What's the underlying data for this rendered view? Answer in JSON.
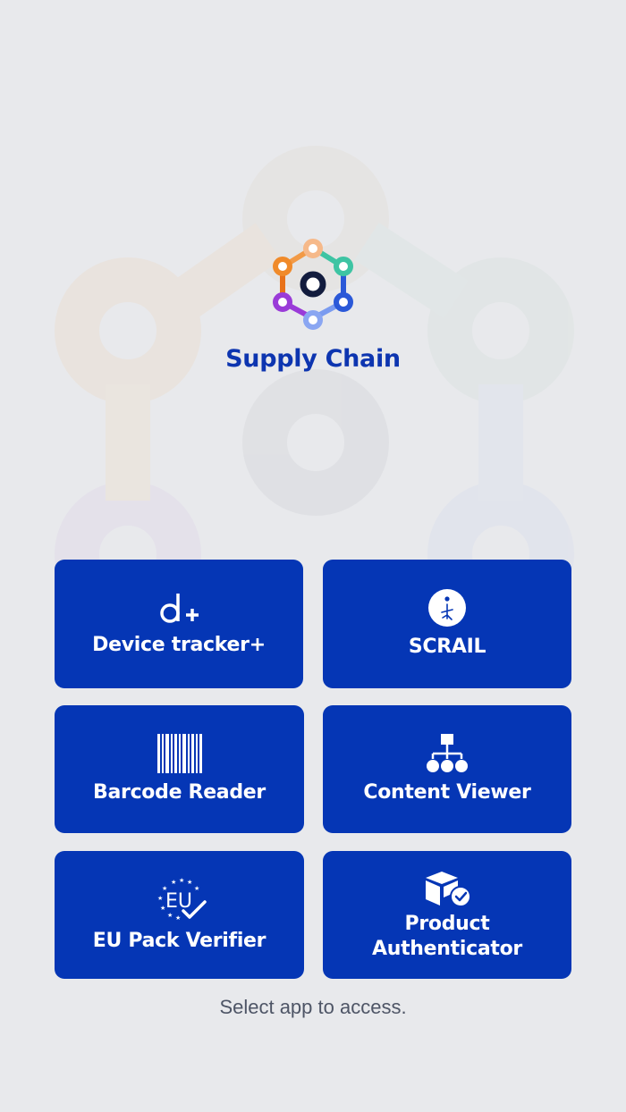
{
  "app": {
    "title": "Supply Chain"
  },
  "tiles": [
    {
      "label": "Device tracker+",
      "icon": "device-tracker-icon"
    },
    {
      "label": "SCRAIL",
      "icon": "scrail-info-icon"
    },
    {
      "label": "Barcode Reader",
      "icon": "barcode-icon"
    },
    {
      "label": "Content Viewer",
      "icon": "hierarchy-icon"
    },
    {
      "label": "EU Pack Verifier",
      "icon": "eu-verify-icon"
    },
    {
      "label": "Product Authenticator",
      "icon": "box-check-icon"
    }
  ],
  "footer": {
    "hint": "Select app to access."
  },
  "colors": {
    "tile": "#0536b5",
    "title": "#0d35b0",
    "background": "#e8e9ec"
  }
}
